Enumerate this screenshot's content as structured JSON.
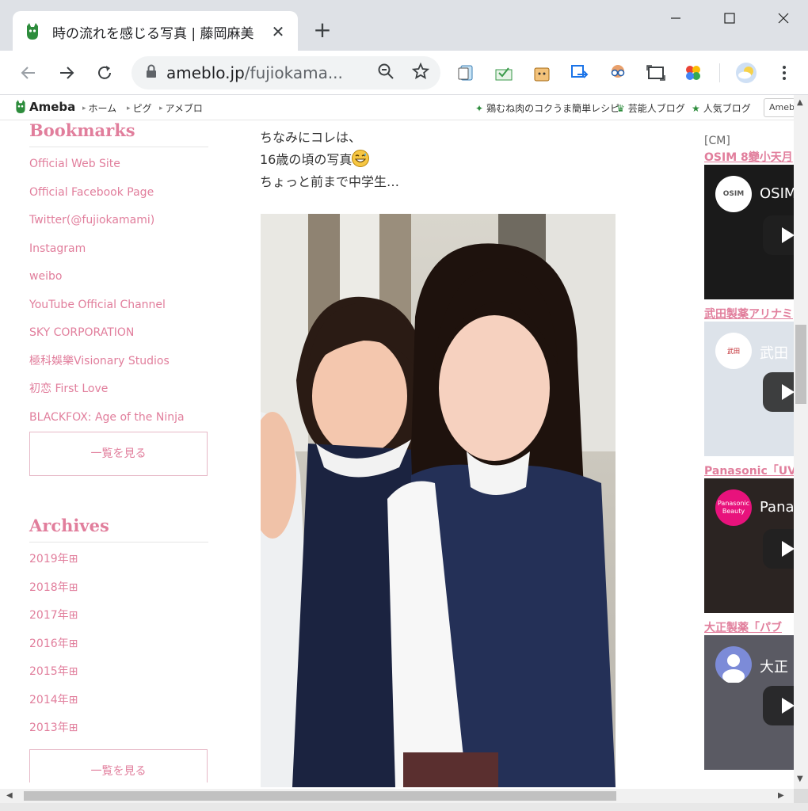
{
  "browser": {
    "tab_title": "時の流れを感じる写真 | 藤岡麻美",
    "tab_close": "✕",
    "new_tab": "+",
    "url_host": "ameblo.jp",
    "url_path": "/fujiokama..."
  },
  "ameba_bar": {
    "logo": "Ameba",
    "nav": [
      "ホーム",
      "ピグ",
      "アメブロ"
    ],
    "right_links": [
      "鶏むね肉のコクうま簡単レシピ",
      "芸能人ブログ",
      "人気ブログ"
    ],
    "right_button": "Ameb"
  },
  "sidebar": {
    "bookmarks_heading": "Bookmarks",
    "bookmarks": [
      "Official Web Site",
      "Official Facebook Page",
      "Twitter(@fujiokamami)",
      "Instagram",
      "weibo",
      "YouTube Official Channel",
      "SKY CORPORATION",
      "極科娛樂Visionary Studios",
      "初恋 First Love",
      "BLACKFOX: Age of the Ninja"
    ],
    "see_all": "一覧を見る",
    "archives_heading": "Archives",
    "archives": [
      "2019年",
      "2018年",
      "2017年",
      "2016年",
      "2015年",
      "2014年",
      "2013年"
    ],
    "archive_toggle": "⊞",
    "see_all_2": "一覧を見る"
  },
  "article": {
    "lines": [
      "ちなみにコレは、",
      "16歳の頃の写真",
      "ちょっと前まで中学生…"
    ]
  },
  "ads": {
    "label": "[CM]",
    "items": [
      {
        "title": "OSIM 8變小天月",
        "channel": "OSIM",
        "logo_text": "OSIM"
      },
      {
        "title": "武田製薬アリナミ",
        "channel": "武田",
        "logo_text": "武田"
      },
      {
        "title": "Panasonic「UV",
        "channel": "Pana",
        "logo_text": "Panasonic Beauty"
      },
      {
        "title": "大正製薬「パブ",
        "channel": "大正",
        "logo_text": ""
      }
    ]
  }
}
